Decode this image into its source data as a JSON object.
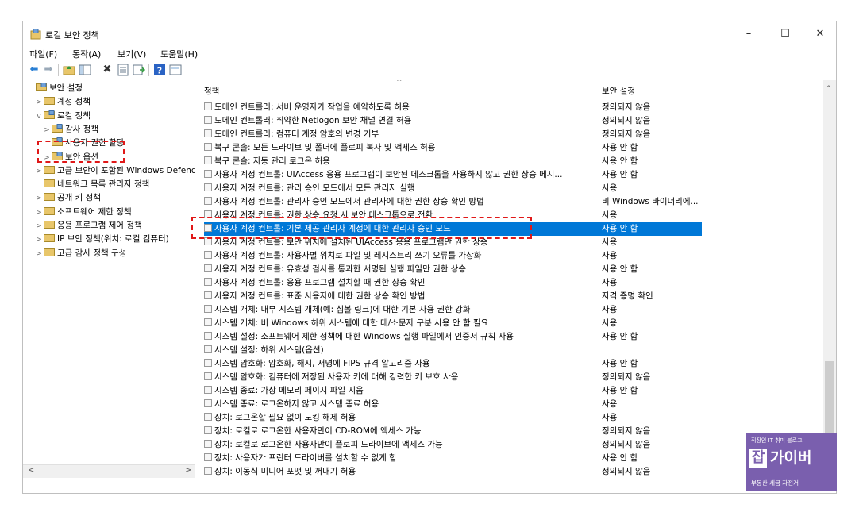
{
  "window": {
    "title": "로컬 보안 정책",
    "controls": {
      "minimize": "–",
      "maximize": "☐",
      "close": "✕"
    }
  },
  "menu": [
    "파일(F)",
    "동작(A)",
    "보기(V)",
    "도움말(H)"
  ],
  "tree": [
    {
      "label": "보안 설정",
      "indent": 0,
      "twisty": ""
    },
    {
      "label": "계정 정책",
      "indent": 1,
      "twisty": ">"
    },
    {
      "label": "로컬 정책",
      "indent": 1,
      "twisty": "v"
    },
    {
      "label": "감사 정책",
      "indent": 2,
      "twisty": ">"
    },
    {
      "label": "사용자 권한 할당",
      "indent": 2,
      "twisty": ""
    },
    {
      "label": "보안 옵션",
      "indent": 2,
      "twisty": ">"
    },
    {
      "label": "고급 보안이 포함된 Windows Defender",
      "indent": 1,
      "twisty": ">"
    },
    {
      "label": "네트워크 목록 관리자 정책",
      "indent": 1,
      "twisty": ""
    },
    {
      "label": "공개 키 정책",
      "indent": 1,
      "twisty": ">"
    },
    {
      "label": "소프트웨어 제한 정책",
      "indent": 1,
      "twisty": ">"
    },
    {
      "label": "응용 프로그램 제어 정책",
      "indent": 1,
      "twisty": ">"
    },
    {
      "label": "IP 보안 정책(위치: 로컬 컴퓨터)",
      "indent": 1,
      "twisty": ">"
    },
    {
      "label": "고급 감사 정책 구성",
      "indent": 1,
      "twisty": ">"
    }
  ],
  "scroll_arrows": {
    "left": "<",
    "right": ">",
    "up": "^",
    "down": "v"
  },
  "columns": {
    "policy": "정책",
    "setting": "보안 설정"
  },
  "policies": [
    {
      "policy": "도메인 컨트롤러: 서버 운영자가 작업을 예약하도록 허용",
      "setting": "정의되지 않음"
    },
    {
      "policy": "도메인 컨트롤러: 취약한 Netlogon 보안 채널 연결 허용",
      "setting": "정의되지 않음"
    },
    {
      "policy": "도메인 컨트롤러: 컴퓨터 계정 암호의 변경 거부",
      "setting": "정의되지 않음"
    },
    {
      "policy": "복구 콘솔: 모든 드라이브 및 폴더에 플로피 복사 및 액세스 허용",
      "setting": "사용 안 함"
    },
    {
      "policy": "복구 콘솔: 자동 관리 로그온 허용",
      "setting": "사용 안 함"
    },
    {
      "policy": "사용자 계정 컨트롤: UIAccess 응용 프로그램이 보안된 데스크톱을 사용하지 않고 권한 상승 메시...",
      "setting": "사용 안 함"
    },
    {
      "policy": "사용자 계정 컨트롤: 관리 승인 모드에서 모든 관리자 실행",
      "setting": "사용"
    },
    {
      "policy": "사용자 계정 컨트롤: 관리자 승인 모드에서 관리자에 대한 권한 상승 확인 방법",
      "setting": "비 Windows 바이너리에..."
    },
    {
      "policy": "사용자 계정 컨트롤: 권한 상승 요청 시 보안 데스크톱으로 전환",
      "setting": "사용"
    },
    {
      "policy": "사용자 계정 컨트롤: 기본 제공 관리자 계정에 대한 관리자 승인 모드",
      "setting": "사용 안 함",
      "selected": true
    },
    {
      "policy": "사용자 계정 컨트롤: 보안 위치에 설치된 UIAccess 응용 프로그램만 권한 상승",
      "setting": "사용"
    },
    {
      "policy": "사용자 계정 컨트롤: 사용자별 위치로 파일 및 레지스트리 쓰기 오류를 가상화",
      "setting": "사용"
    },
    {
      "policy": "사용자 계정 컨트롤: 유효성 검사를 통과한 서명된 실행 파일만 권한 상승",
      "setting": "사용 안 함"
    },
    {
      "policy": "사용자 계정 컨트롤: 응용 프로그램 설치할 때 권한 상승 확인",
      "setting": "사용"
    },
    {
      "policy": "사용자 계정 컨트롤: 표준 사용자에 대한 권한 상승 확인 방법",
      "setting": "자격 증명 확인"
    },
    {
      "policy": "시스템 개체: 내부 시스템 개체(예: 심볼 링크)에 대한 기본 사용 권한 강화",
      "setting": "사용"
    },
    {
      "policy": "시스템 개체: 비 Windows 하위 시스템에 대한 대/소문자 구분 사용 안 함 필요",
      "setting": "사용"
    },
    {
      "policy": "시스템 설정: 소프트웨어 제한 정책에 대한 Windows 실행 파일에서 인증서 규칙 사용",
      "setting": "사용 안 함"
    },
    {
      "policy": "시스템 설정: 하위 시스템(옵션)",
      "setting": ""
    },
    {
      "policy": "시스템 암호화: 암호화, 해시, 서명에 FIPS 규격 알고리즘 사용",
      "setting": "사용 안 함"
    },
    {
      "policy": "시스템 암호화: 컴퓨터에 저장된 사용자 키에 대해 강력한 키 보호 사용",
      "setting": "정의되지 않음"
    },
    {
      "policy": "시스템 종료: 가상 메모리 페이지 파일 지움",
      "setting": "사용 안 함"
    },
    {
      "policy": "시스템 종료: 로그온하지 않고 시스템 종료 허용",
      "setting": "사용"
    },
    {
      "policy": "장치: 로그온할 필요 없이 도킹 해제 허용",
      "setting": "사용"
    },
    {
      "policy": "장치: 로컬로 로그온한 사용자만이 CD-ROM에 액세스 가능",
      "setting": "정의되지 않음"
    },
    {
      "policy": "장치: 로컬로 로그온한 사용자만이 플로피 드라이브에 액세스 가능",
      "setting": "정의되지 않음"
    },
    {
      "policy": "장치: 사용자가 프린터 드라이버를 설치할 수 없게 함",
      "setting": "사용 안 함"
    },
    {
      "policy": "장치: 이동식 미디어 포맷 및 꺼내기 허용",
      "setting": "정의되지 않음"
    }
  ],
  "watermark": {
    "line1": "직장인 IT 취미 블로그",
    "logo_left": "잡",
    "logo_right": "가이버",
    "line3": "부동산 세금 자전거"
  },
  "colors": {
    "selection": "#0078d7",
    "highlight_box": "#e01818",
    "watermark_bg": "#7a5fae"
  }
}
